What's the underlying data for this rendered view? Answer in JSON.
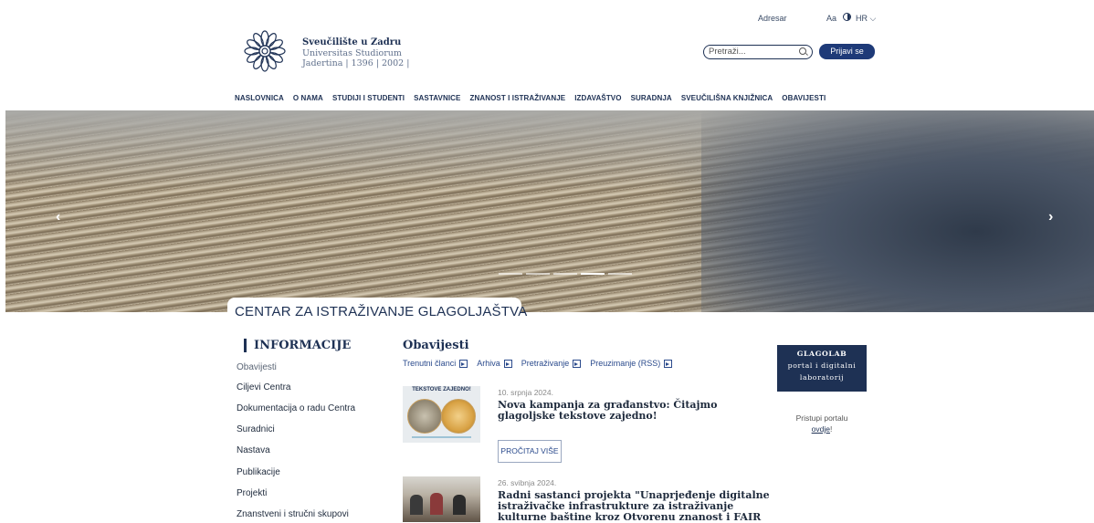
{
  "utility": {
    "adresar": "Adresar",
    "aa": "Aa",
    "lang": "HR ⌵"
  },
  "logo": {
    "title": "Sveučilište u Zadru",
    "sub1": "Universitas Studiorum",
    "sub2": "Jadertina | 1396 | 2002 |"
  },
  "search": {
    "placeholder": "Pretraži..."
  },
  "login": {
    "label": "Prijavi se"
  },
  "nav": [
    "NASLOVNICA",
    "O NAMA",
    "STUDIJI I STUDENTI",
    "SASTAVNICE",
    "ZNANOST I ISTRAŽIVANJE",
    "IZDAVAŠTVO",
    "SURADNJA",
    "SVEUČILIŠNA KNJIŽNICA",
    "OBAVIJESTI"
  ],
  "hero": {
    "prev": "‹",
    "next": "›",
    "caption": "CENTAR ZA ISTRAŽIVANJE GLAGOLJAŠTVA",
    "slides": 5,
    "active_slide": 3
  },
  "sidebar": {
    "heading": "INFORMACIJE",
    "items": [
      "Obavijesti",
      "Ciljevi Centra",
      "Dokumentacija o radu Centra",
      "Suradnici",
      "Nastava",
      "Publikacije",
      "Projekti",
      "Znanstveni i stručni skupovi"
    ]
  },
  "news": {
    "heading": "Obavijesti",
    "tabs": [
      "Trenutni članci",
      "Arhiva",
      "Pretraživanje",
      "Preuzimanje (RSS)"
    ],
    "items": [
      {
        "date": "10. srpnja 2024.",
        "title": "Nova kampanja za građanstvo: Čitajmo glagoljske tekstove zajedno!",
        "img_label": "TEKSTOVE ZAJEDNO!"
      },
      {
        "date": "26. svibnja 2024.",
        "title": "Radni sastanci projekta \"Unaprjeđenje digitalne istraživačke infrastrukture za istraživanje kulturne baštine kroz Otvorenu znanost i FAIR"
      }
    ],
    "read_more": "PROČITAJ VIŠE"
  },
  "glagolab": {
    "line1": "GLAGOLAB",
    "line2": "portal i digitalni",
    "line3": "laboratorij"
  },
  "portal": {
    "text": "Pristupi portalu",
    "link": "ovdje",
    "suffix": "!"
  },
  "colors": {
    "navy": "#1e3154",
    "button": "#1e3a78",
    "link": "#2a4a8c"
  }
}
